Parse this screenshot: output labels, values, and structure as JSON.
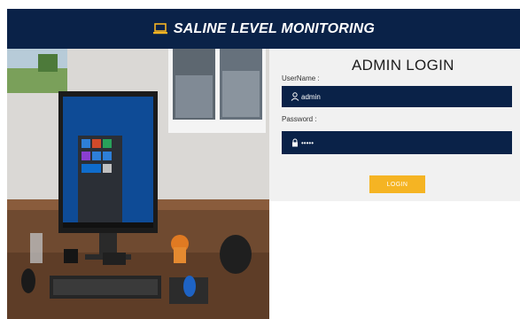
{
  "header": {
    "title": "SALINE LEVEL MONITORING",
    "icon": "laptop-icon"
  },
  "login": {
    "title": "ADMIN LOGIN",
    "username_label": "UserName :",
    "username_value": "admin",
    "password_label": "Password :",
    "password_value": "•••••",
    "button_label": "LOGIN"
  },
  "colors": {
    "header_bg": "#0a2248",
    "field_bg": "#0a2248",
    "button_bg": "#f5b423",
    "panel_bg": "#f1f1f1"
  },
  "photo": {
    "subject": "desktop-workspace-photo"
  }
}
